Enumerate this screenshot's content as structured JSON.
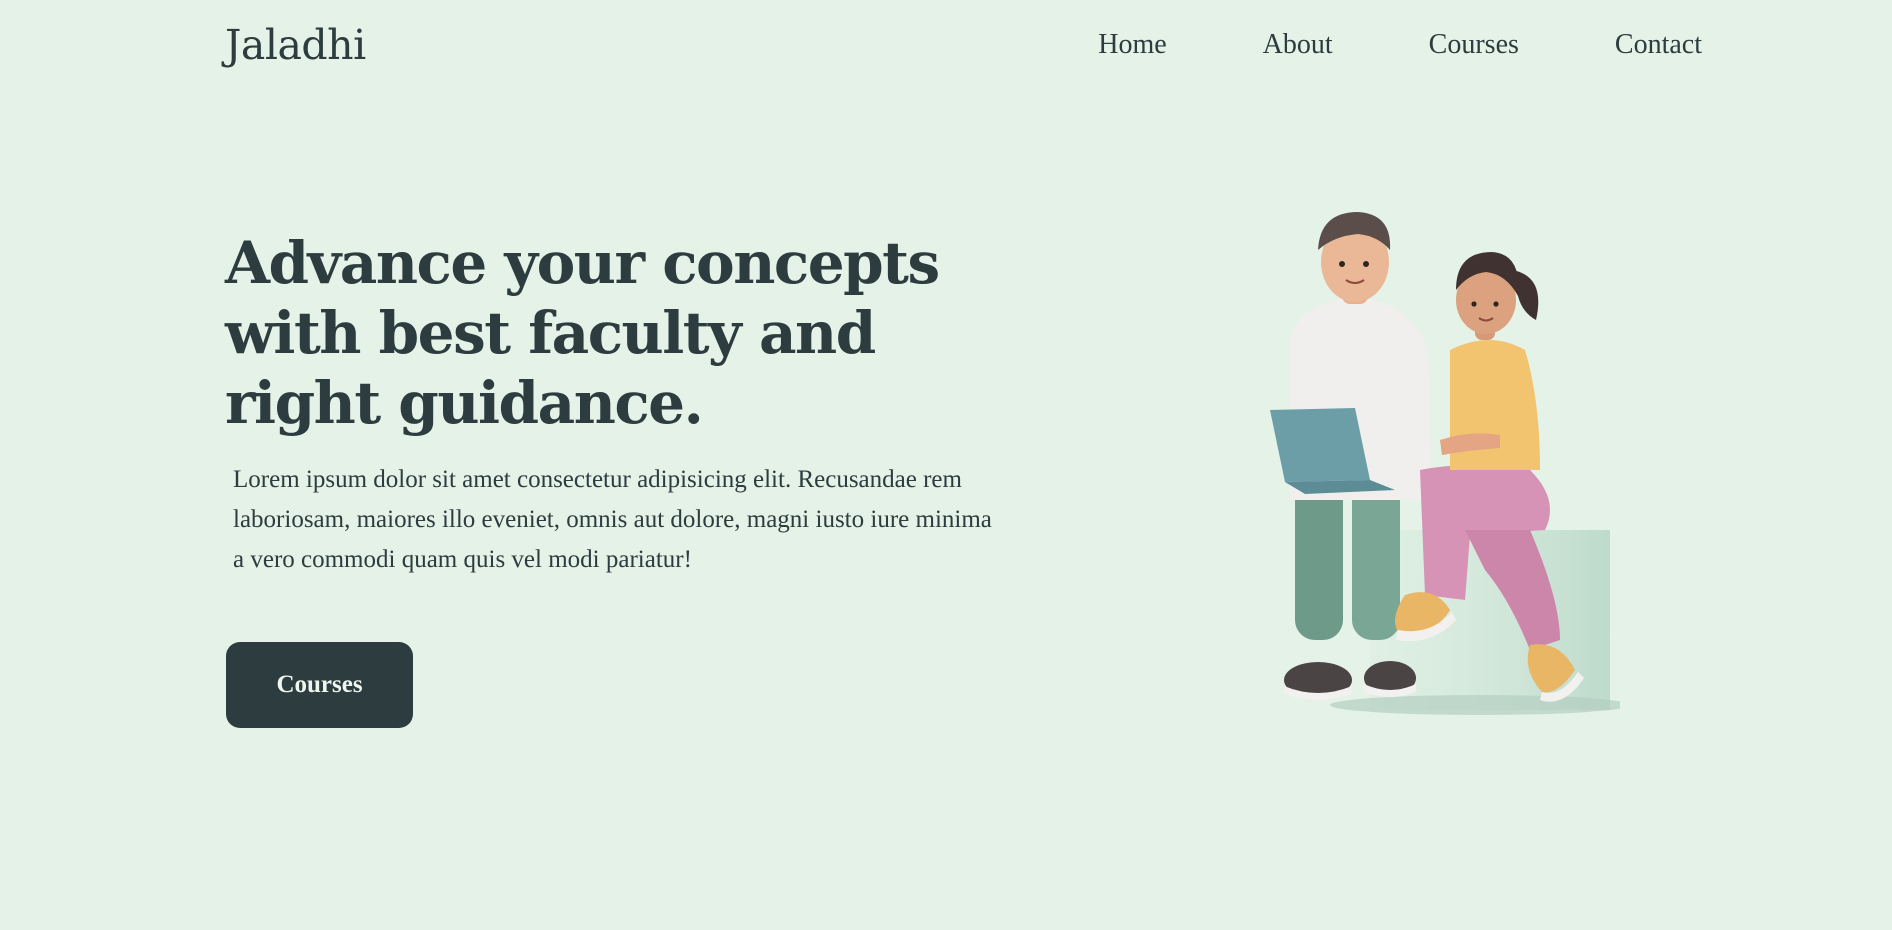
{
  "brand": {
    "name": "Jaladhi"
  },
  "nav": {
    "items": [
      {
        "label": "Home"
      },
      {
        "label": "About"
      },
      {
        "label": "Courses"
      },
      {
        "label": "Contact"
      }
    ]
  },
  "hero": {
    "title": "Advance your concepts with best faculty and right guidance.",
    "description": "Lorem ipsum dolor sit amet consectetur adipisicing elit. Recusandae rem laboriosam, maiores illo eveniet, omnis aut dolore, magni iusto iure minima a vero commodi quam quis vel modi pariatur!",
    "cta_label": "Courses"
  },
  "theme": {
    "background": "#e4f2e7",
    "text": "#2c3c3f",
    "button_bg": "#2c3c3f",
    "button_text": "#eef6ef"
  },
  "illustration": {
    "icon": "students-with-laptop-illustration"
  }
}
